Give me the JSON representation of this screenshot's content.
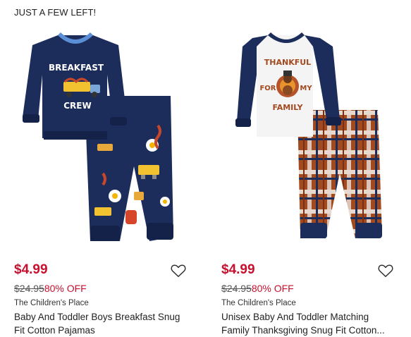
{
  "products": [
    {
      "stock_flag": "JUST A FEW LEFT!",
      "shirt_text_top": "BREAKFAST",
      "shirt_text_bottom": "CREW",
      "sale_price": "$4.99",
      "original_price": "$24.95",
      "discount": "80% OFF",
      "brand": "The Children's Place",
      "title_line1": "Baby And Toddler Boys Breakfast Snug",
      "title_line2": "Fit Cotton Pajamas",
      "wishlist_icon": "heart-outline-icon"
    },
    {
      "shirt_text_top": "THANKFUL",
      "shirt_text_for": "FOR",
      "shirt_text_my": "MY",
      "shirt_text_bottom": "FAMILY",
      "sale_price": "$4.99",
      "original_price": "$24.95",
      "discount": "80% OFF",
      "brand": "The Children's Place",
      "title_line1": "Unisex Baby And Toddler Matching",
      "title_line2": "Family Thanksgiving Snug Fit Cotton...",
      "wishlist_icon": "heart-outline-icon"
    }
  ],
  "colors": {
    "sale": "#c8102e",
    "navy": "#1c2d5c",
    "trim_blue": "#5b8fd6"
  }
}
